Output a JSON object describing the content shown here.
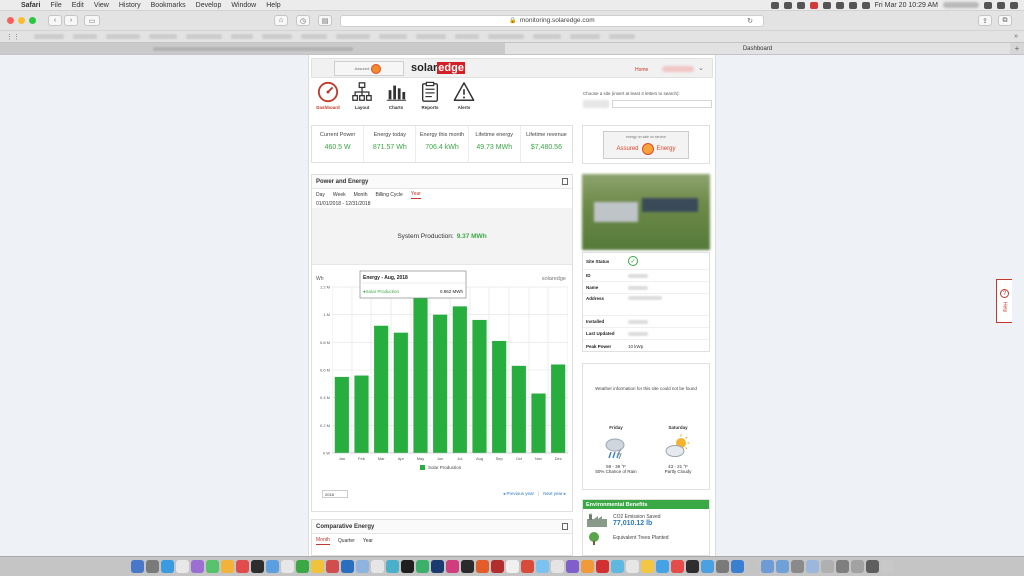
{
  "menubar": {
    "app": "Safari",
    "items": [
      "File",
      "Edit",
      "View",
      "History",
      "Bookmarks",
      "Develop",
      "Window",
      "Help"
    ],
    "clock": "Fri Mar 20  10:29 AM"
  },
  "browser": {
    "url": "monitoring.solaredge.com",
    "tabs": [
      "",
      "Dashboard"
    ]
  },
  "header": {
    "brand_a": "solar",
    "brand_b": "edge",
    "partner_mini": "Assured",
    "home": "Home"
  },
  "nav": [
    {
      "label": "Dashboard",
      "icon": "gauge-icon"
    },
    {
      "label": "Layout",
      "icon": "sitemap-icon"
    },
    {
      "label": "Charts",
      "icon": "bar-chart-icon"
    },
    {
      "label": "Reports",
      "icon": "report-icon"
    },
    {
      "label": "Alerts",
      "icon": "alert-icon"
    }
  ],
  "site_search": {
    "hint": "Choose a site (insert at least 3 letters to search):"
  },
  "kpis": [
    {
      "title": "Current Power",
      "value": "460.5 W"
    },
    {
      "title": "Energy today",
      "value": "871.57 Wh"
    },
    {
      "title": "Energy this month",
      "value": "706.4 kWh"
    },
    {
      "title": "Lifetime energy",
      "value": "49.73 MWh"
    },
    {
      "title": "Lifetime revenue",
      "value": "$7,480.56"
    }
  ],
  "partner_logo": {
    "tagline": "energy on sale on service",
    "left": "Assured",
    "right": "Energy"
  },
  "power_energy": {
    "title": "Power and Energy",
    "tabs": [
      "Day",
      "Week",
      "Month",
      "Billing Cycle",
      "Year"
    ],
    "selected_tab": "Year",
    "date_range": "01/01/2018 - 12/31/2018",
    "system_production_label": "System Production:",
    "system_production_value": "9.37 MWh",
    "year_select": "2018",
    "prev": "Previous year",
    "next": "Next year"
  },
  "chart_data": {
    "type": "bar",
    "ylabel": "Wh",
    "ylim": [
      0,
      1.2
    ],
    "yticks": [
      "0 W",
      "0.2 M",
      "0.4 M",
      "0.6 M",
      "0.8 M",
      "1 M",
      "1.2 M"
    ],
    "categories": [
      "Jan",
      "Feb",
      "Mar",
      "Apr",
      "May",
      "Jun",
      "Jul",
      "Aug",
      "Sep",
      "Oct",
      "Nov",
      "Dec"
    ],
    "series": [
      {
        "name": "Solar Production",
        "values": [
          0.55,
          0.56,
          0.92,
          0.87,
          1.13,
          1.0,
          1.06,
          0.962,
          0.81,
          0.63,
          0.43,
          0.64
        ]
      }
    ],
    "color": "#27ae3f",
    "tooltip": {
      "title": "Energy - Aug, 2018",
      "series": "Solar Production",
      "value": "0.962 MWh"
    },
    "watermark": "solaredge"
  },
  "comparative": {
    "title": "Comparative Energy",
    "tabs": [
      "Month",
      "Quarter",
      "Year"
    ],
    "selected_tab": "Month"
  },
  "site_info": {
    "rows": [
      {
        "k": "Site Status"
      },
      {
        "k": "ID"
      },
      {
        "k": "Name"
      },
      {
        "k": "Address"
      },
      {
        "k": "Installed"
      },
      {
        "k": "Last Updated"
      },
      {
        "k": "Peak Power",
        "v": "10 kWp"
      }
    ]
  },
  "weather": {
    "message": "Weather information for this site could not be found",
    "days": [
      {
        "day": "Friday",
        "temps": "59 - 39 °F",
        "desc": "50% Chance of Rain",
        "icon": "rain-cloud-icon"
      },
      {
        "day": "Saturday",
        "temps": "43 - 21 °F",
        "desc": "Partly Cloudy",
        "icon": "partly-cloudy-icon"
      }
    ]
  },
  "environmental": {
    "title": "Environmental Benefits",
    "co2_label": "CO2 Emission Saved",
    "co2_value": "77,010.12 lb",
    "trees_label": "Equivalent Trees Planted"
  },
  "help": {
    "label": "Help"
  }
}
